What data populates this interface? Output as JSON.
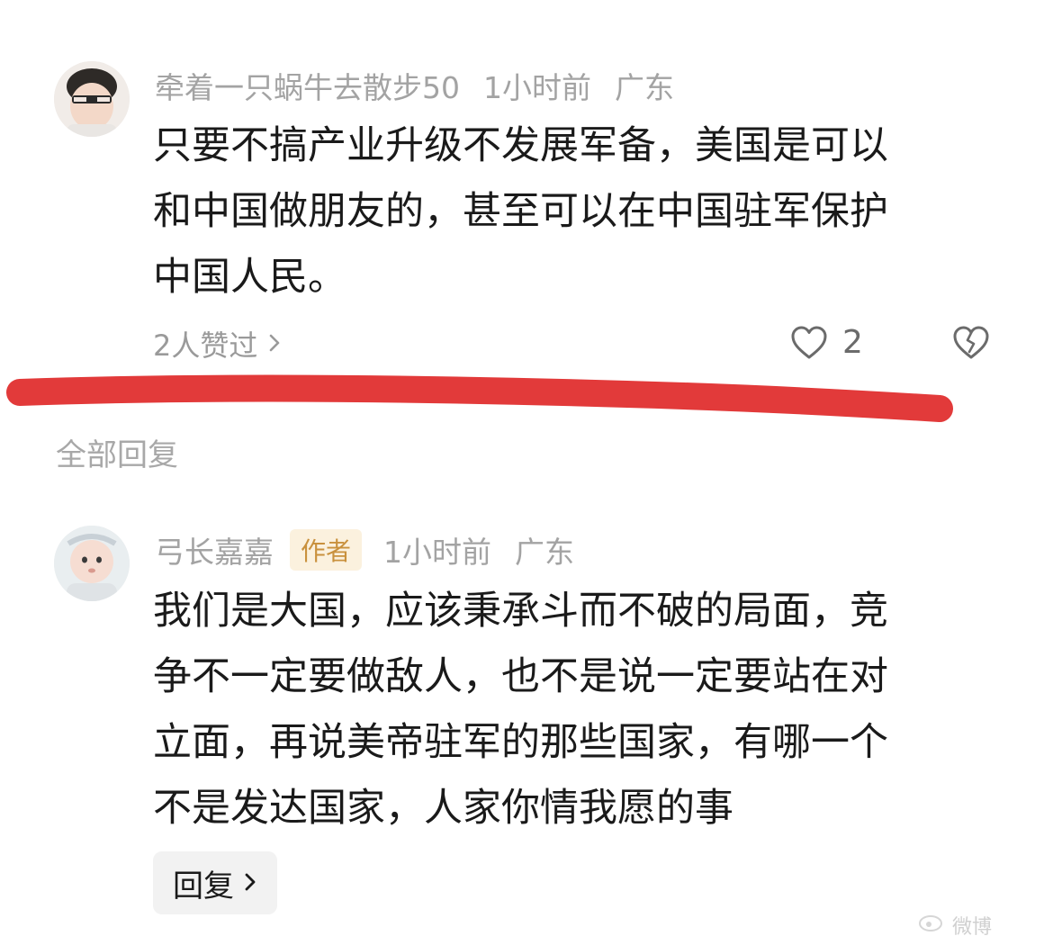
{
  "comment": {
    "username": "牵着一只蜗牛去散步50",
    "time": "1小时前",
    "location": "广东",
    "lines": [
      "只要不搞产业升级不发展军备，美国是可以",
      "和中国做朋友的，甚至可以在中国驻军保护",
      "中国人民。"
    ],
    "liked_by": "2人赞过",
    "like_count": "2"
  },
  "replies_section": {
    "title": "全部回复"
  },
  "reply": {
    "username": "弓长嘉嘉",
    "badge": "作者",
    "time": "1小时前",
    "location": "广东",
    "lines": [
      "我们是大国，应该秉承斗而不破的局面，竞",
      "争不一定要做敌人，也不是说一定要站在对",
      "立面，再说美帝驻军的那些国家，有哪一个",
      "不是发达国家，人家你情我愿的事"
    ],
    "reply_button": "回复"
  },
  "annotation": {
    "color": "#e23a3a"
  },
  "watermark": {
    "text": "微博"
  }
}
